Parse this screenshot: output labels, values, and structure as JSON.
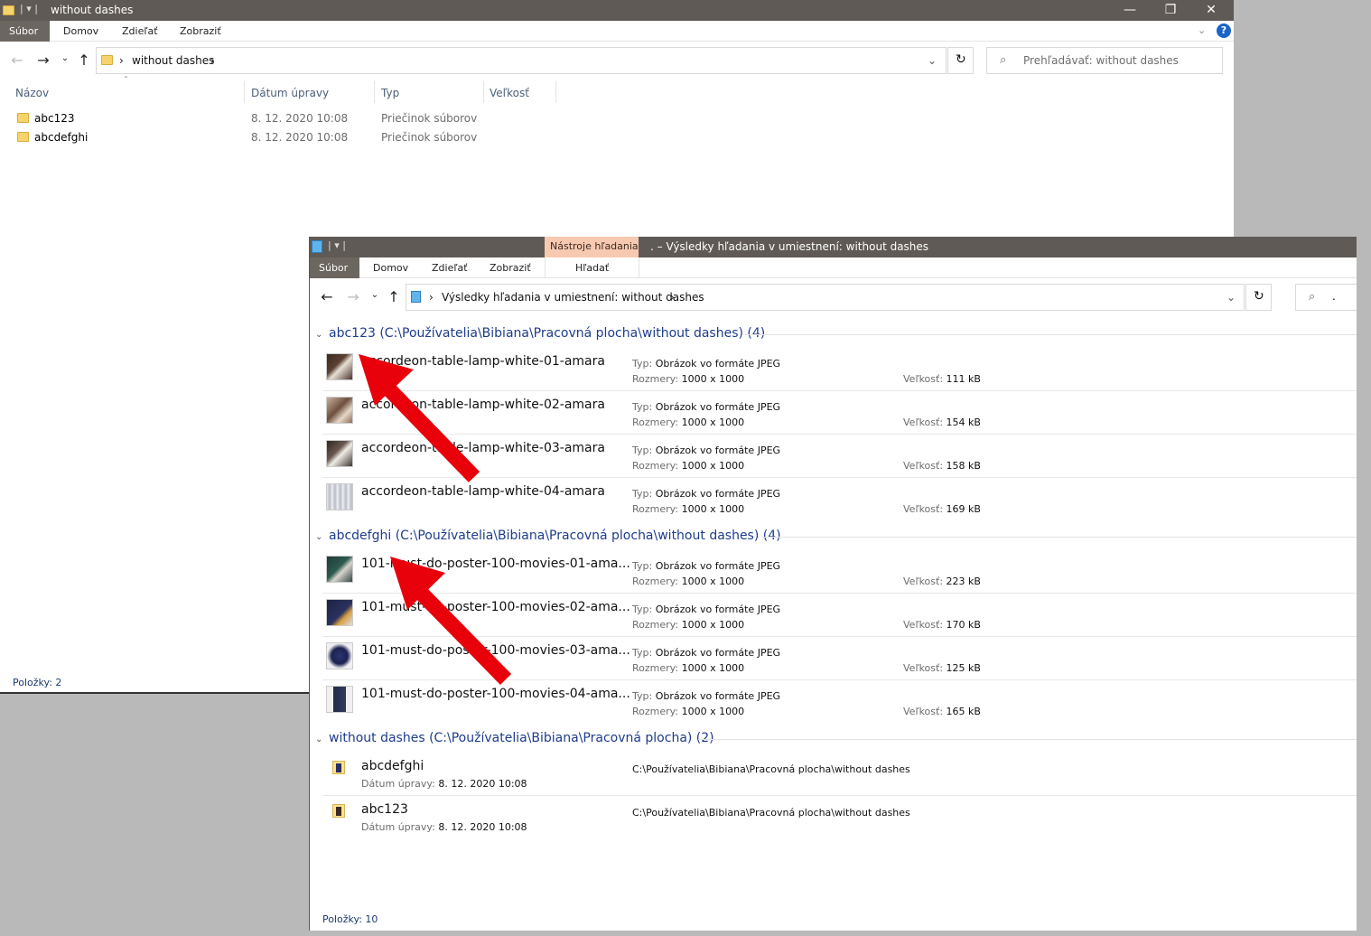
{
  "back_window": {
    "title": "without dashes",
    "ribbon_tabs": [
      "Súbor",
      "Domov",
      "Zdieľať",
      "Zobraziť"
    ],
    "address": "without dashes",
    "search_placeholder": "Prehľadávať: without dashes",
    "columns": [
      "Názov",
      "Dátum úpravy",
      "Typ",
      "Veľkosť"
    ],
    "rows": [
      {
        "name": "abc123",
        "date": "8. 12. 2020 10:08",
        "type": "Priečinok súborov"
      },
      {
        "name": "abcdefghi",
        "date": "8. 12. 2020 10:08",
        "type": "Priečinok súborov"
      }
    ],
    "status": "Položky: 2"
  },
  "front_window": {
    "context_tab": "Nástroje hľadania",
    "title": ". – Výsledky hľadania v umiestnení: without dashes",
    "ribbon_tabs": [
      "Súbor",
      "Domov",
      "Zdieľať",
      "Zobraziť",
      "Hľadať"
    ],
    "address": "Výsledky hľadania v umiestnení: without dashes",
    "search_value": ".",
    "labels": {
      "type": "Typ:",
      "dims": "Rozmery:",
      "size": "Veľkosť:",
      "modified": "Dátum úpravy:"
    },
    "groups": [
      {
        "header": "abc123 (C:\\Používatelia\\Bibiana\\Pracovná plocha\\without dashes) (4)",
        "items": [
          {
            "name": "accordeon-table-lamp-white-01-amara",
            "type": "Obrázok vo formáte JPEG",
            "dims": "1000 x 1000",
            "size": "111 kB"
          },
          {
            "name": "accordeon-table-lamp-white-02-amara",
            "type": "Obrázok vo formáte JPEG",
            "dims": "1000 x 1000",
            "size": "154 kB"
          },
          {
            "name": "accordeon-table-lamp-white-03-amara",
            "type": "Obrázok vo formáte JPEG",
            "dims": "1000 x 1000",
            "size": "158 kB"
          },
          {
            "name": "accordeon-table-lamp-white-04-amara",
            "type": "Obrázok vo formáte JPEG",
            "dims": "1000 x 1000",
            "size": "169 kB"
          }
        ]
      },
      {
        "header": "abcdefghi (C:\\Používatelia\\Bibiana\\Pracovná plocha\\without dashes) (4)",
        "items": [
          {
            "name": "101-must-do-poster-100-movies-01-ama...",
            "type": "Obrázok vo formáte JPEG",
            "dims": "1000 x 1000",
            "size": "223 kB"
          },
          {
            "name": "101-must-do-poster-100-movies-02-ama...",
            "type": "Obrázok vo formáte JPEG",
            "dims": "1000 x 1000",
            "size": "170 kB"
          },
          {
            "name": "101-must-do-poster-100-movies-03-ama...",
            "type": "Obrázok vo formáte JPEG",
            "dims": "1000 x 1000",
            "size": "125 kB"
          },
          {
            "name": "101-must-do-poster-100-movies-04-ama...",
            "type": "Obrázok vo formáte JPEG",
            "dims": "1000 x 1000",
            "size": "165 kB"
          }
        ]
      },
      {
        "header": "without dashes (C:\\Používatelia\\Bibiana\\Pracovná plocha) (2)",
        "folders": [
          {
            "name": "abcdefghi",
            "modified": "8. 12. 2020 10:08",
            "path": "C:\\Používatelia\\Bibiana\\Pracovná plocha\\without dashes"
          },
          {
            "name": "abc123",
            "modified": "8. 12. 2020 10:08",
            "path": "C:\\Používatelia\\Bibiana\\Pracovná plocha\\without dashes"
          }
        ]
      }
    ],
    "status": "Položky: 10"
  },
  "colors": {
    "titlebar": "#5f5a55",
    "file_tab": "#6c6660",
    "context_tab": "#f8c9b1",
    "group_header": "#1e3c8c",
    "annotation_arrow": "#e8000b"
  }
}
